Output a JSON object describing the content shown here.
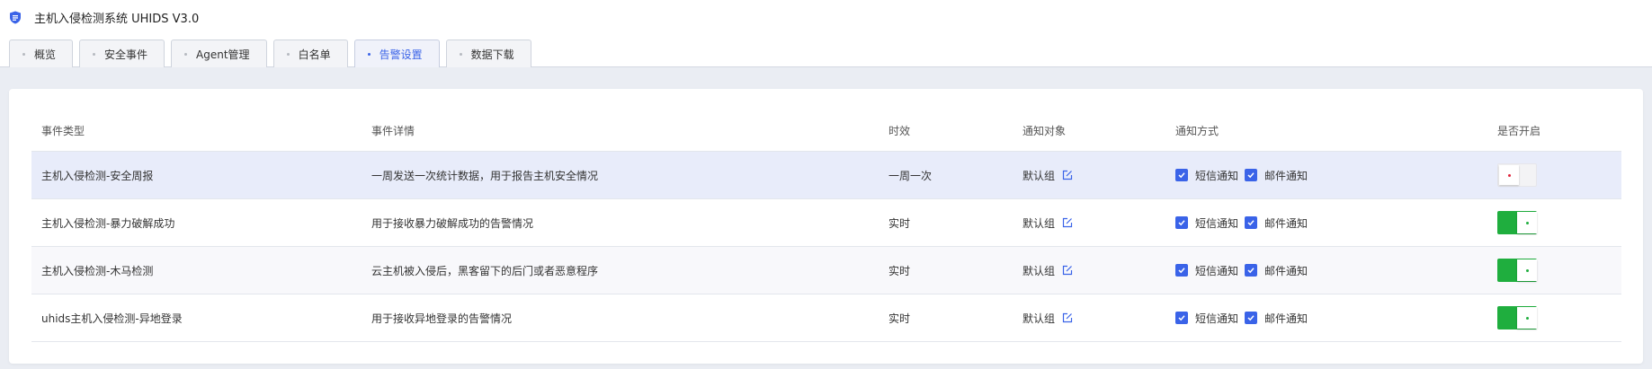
{
  "app": {
    "title": "主机入侵检测系统 UHIDS V3.0",
    "accent_color": "#3a63e8"
  },
  "tabs": [
    {
      "label": "概览",
      "active": false
    },
    {
      "label": "安全事件",
      "active": false
    },
    {
      "label": "Agent管理",
      "active": false
    },
    {
      "label": "白名单",
      "active": false
    },
    {
      "label": "告警设置",
      "active": true
    },
    {
      "label": "数据下载",
      "active": false
    }
  ],
  "table": {
    "headers": {
      "event_type": "事件类型",
      "event_detail": "事件详情",
      "timeliness": "时效",
      "notify_target": "通知对象",
      "notify_method": "通知方式",
      "enabled": "是否开启"
    },
    "rows": [
      {
        "event_type": "主机入侵检测-安全周报",
        "event_detail": "一周发送一次统计数据，用于报告主机安全情况",
        "timeliness": "一周一次",
        "notify_target": "默认组",
        "sms_label": "短信通知",
        "sms_checked": true,
        "email_label": "邮件通知",
        "email_checked": true,
        "enabled": false
      },
      {
        "event_type": "主机入侵检测-暴力破解成功",
        "event_detail": "用于接收暴力破解成功的告警情况",
        "timeliness": "实时",
        "notify_target": "默认组",
        "sms_label": "短信通知",
        "sms_checked": true,
        "email_label": "邮件通知",
        "email_checked": true,
        "enabled": true
      },
      {
        "event_type": "主机入侵检测-木马检测",
        "event_detail": "云主机被入侵后，黑客留下的后门或者恶意程序",
        "timeliness": "实时",
        "notify_target": "默认组",
        "sms_label": "短信通知",
        "sms_checked": true,
        "email_label": "邮件通知",
        "email_checked": true,
        "enabled": true
      },
      {
        "event_type": "uhids主机入侵检测-异地登录",
        "event_detail": "用于接收异地登录的告警情况",
        "timeliness": "实时",
        "notify_target": "默认组",
        "sms_label": "短信通知",
        "sms_checked": true,
        "email_label": "邮件通知",
        "email_checked": true,
        "enabled": true
      }
    ]
  }
}
